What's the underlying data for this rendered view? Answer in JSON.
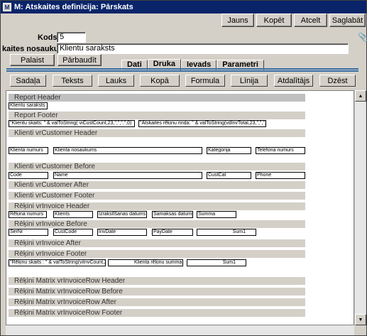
{
  "window": {
    "title": "M: Atskaites definīcija: Pārskats"
  },
  "toolbar": {
    "new": "Jauns",
    "copy": "Kopēt",
    "cancel": "Atcelt",
    "save": "Saglabāt"
  },
  "form": {
    "code_label": "Kods:",
    "code_value": "5",
    "name_label": "kaites nosaukums:",
    "name_value": "Klientu saraksts"
  },
  "actions": {
    "run": "Palaist",
    "check": "Pārbaudīt"
  },
  "tabs": [
    "Dati",
    "Druka",
    "Ievads",
    "Parametri"
  ],
  "active_tab": "Druka",
  "tools": [
    "Sadaļa",
    "Teksts",
    "Lauks",
    "Kopā",
    "Formula",
    "Līnija",
    "Atdalītājs",
    "Dzēst"
  ],
  "sections": [
    "Report Header",
    "Report Footer",
    "Klienti vrCustomer Header",
    "Klienti vrCustomer Before",
    "Klienti vrCustomer After",
    "Klienti vrCustomer Footer",
    "Rēķini vrInvoice Header",
    "Rēķini vrInvoice Before",
    "Rēķini vrInvoice After",
    "Rēķini vrInvoice Footer",
    "Rēķini Matrix vrInvoiceRow Header",
    "Rēķini Matrix vrInvoiceRow Before",
    "Rēķini Matrix vrInvoiceRow After",
    "Rēķini Matrix vrInvoiceRow Footer"
  ],
  "fields": {
    "report_header_title": "Klientu saraksts",
    "rf_clients_count": "\"Klientu skaits: \" & valToString( viCustCount,23,\",\",\".\",0)",
    "rf_total": "\"Atskaites rēķinu rinda: \" & valToString(vdInvTotal,23,\",\",\".\",0)",
    "ch_num": "Klienta numurs",
    "ch_name": "Klienta nosaukums",
    "ch_cat": "Kategorija",
    "ch_phone": "Telefona numurs",
    "cb_code": "Code",
    "cb_name": "Name",
    "cb_cat": "CustCat",
    "cb_phone": "Phone",
    "ih_num": "Rēķina numurs",
    "ih_client": "Klients",
    "ih_date": "Izrakstīšanas datums",
    "ih_paydate": "Samaksas datums",
    "ih_sum": "Summa",
    "ib_sernr": "SerNr",
    "ib_code": "CustCode",
    "ib_date": "InvDate",
    "ib_paydate": "PayDate",
    "ib_sum": "Sum1",
    "if_count": "\"Rēķinu skaits : \" & valToString(viInvCount,23,\",\",\".\",0)",
    "if_total_label": "Klienta rēķinu summa",
    "if_sum": "Sum1"
  }
}
